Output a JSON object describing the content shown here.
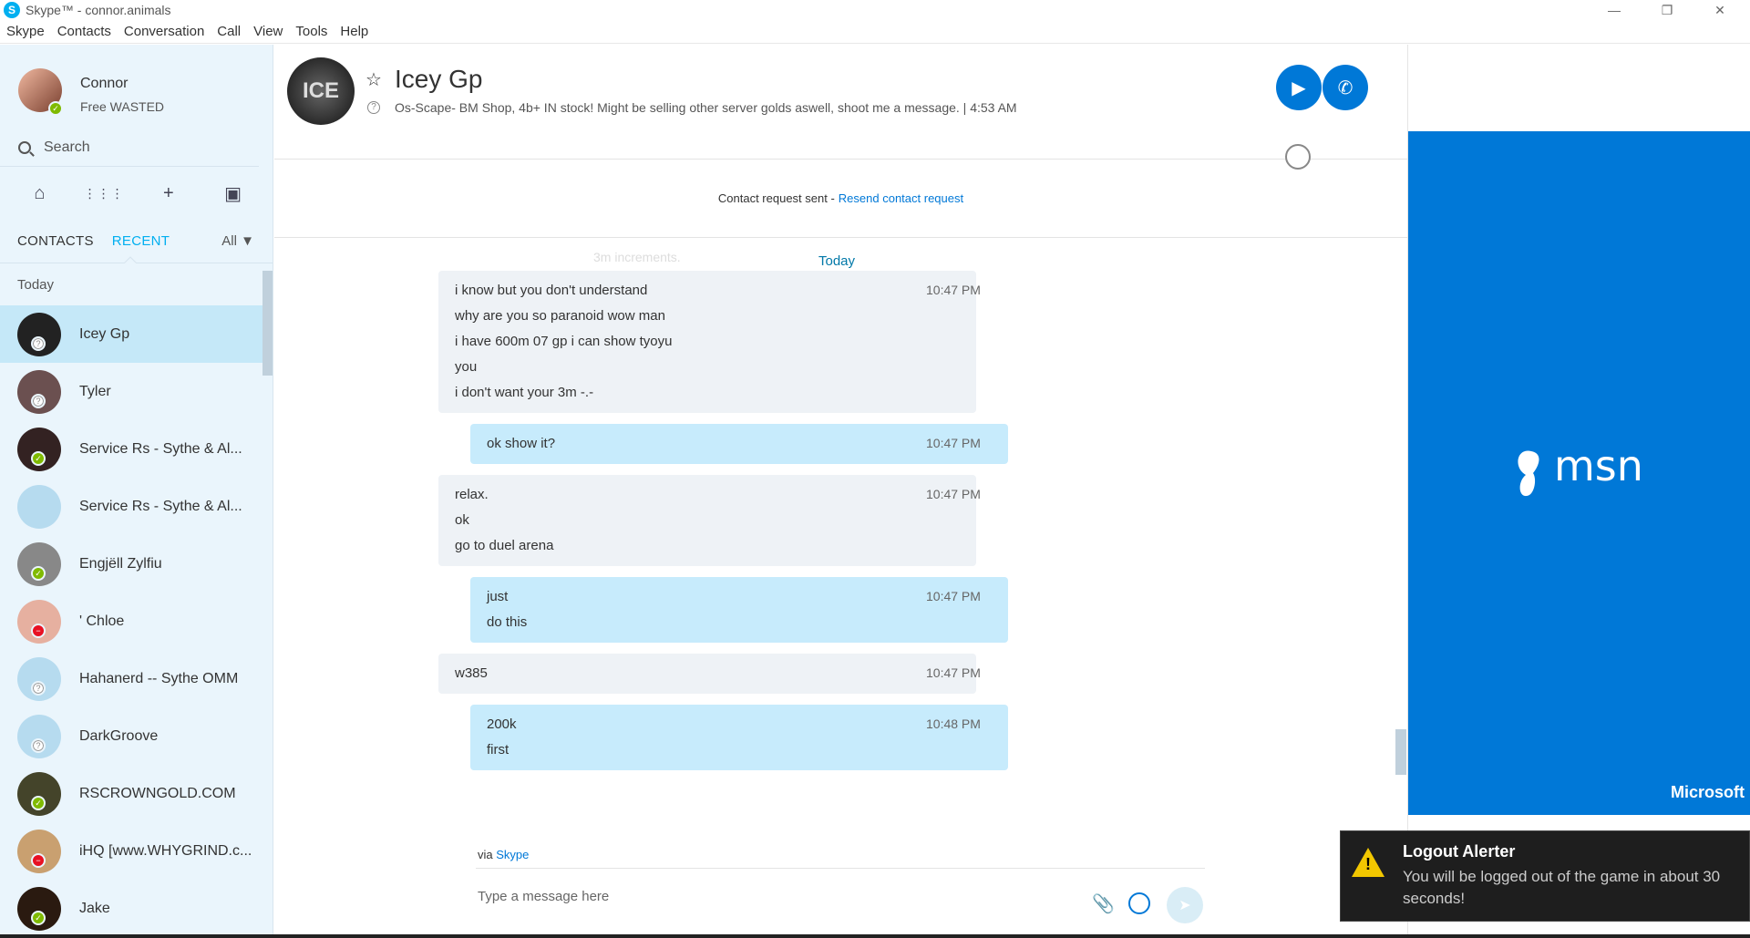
{
  "window": {
    "title": "Skype™ - connor.animals",
    "controls": [
      "minimize",
      "restore",
      "close"
    ]
  },
  "menu": [
    "Skype",
    "Contacts",
    "Conversation",
    "Call",
    "View",
    "Tools",
    "Help"
  ],
  "profile": {
    "name": "Connor",
    "mood": "Free WASTED",
    "presence": "online"
  },
  "search": {
    "placeholder": "Search"
  },
  "icons": [
    "home-icon",
    "dialpad-icon",
    "add-icon",
    "contact-card-icon"
  ],
  "tabs": {
    "contacts": "CONTACTS",
    "recent": "RECENT",
    "filter": "All"
  },
  "list_section": "Today",
  "contacts": [
    {
      "name": "Icey Gp",
      "status": "unknown",
      "active": true,
      "color": "#222222"
    },
    {
      "name": "Tyler",
      "status": "unknown",
      "active": false,
      "color": "#6b5050"
    },
    {
      "name": "Service Rs - Sythe & Al...",
      "status": "online",
      "active": false,
      "color": "#332222"
    },
    {
      "name": "Service Rs - Sythe & Al...",
      "status": "group",
      "active": false,
      "color": "#b6dbef"
    },
    {
      "name": "Engjëll Zylfiu",
      "status": "online",
      "active": false,
      "color": "#888888"
    },
    {
      "name": "' Chloe",
      "status": "dnd",
      "active": false,
      "color": "#e6b0a0"
    },
    {
      "name": "Hahanerd -- Sythe OMM",
      "status": "unknown",
      "active": false,
      "color": "#b6dbef"
    },
    {
      "name": "DarkGroove",
      "status": "unknown",
      "active": false,
      "color": "#b6dbef"
    },
    {
      "name": "RSCROWNGOLD.COM",
      "status": "online",
      "active": false,
      "color": "#44442a"
    },
    {
      "name": "iHQ [www.WHYGRIND.c...",
      "status": "dnd",
      "active": false,
      "color": "#c9a070"
    },
    {
      "name": "Jake",
      "status": "online",
      "active": false,
      "color": "#2a1a10"
    }
  ],
  "chat": {
    "name": "Icey Gp",
    "mood": "Os-Scape- BM Shop, 4b+ IN stock! Might be selling other server golds aswell, shoot me a message.  |  4:53 AM",
    "request_text": "Contact request sent -",
    "request_link": "Resend contact request",
    "day": "Today",
    "ghost": "3m increments.",
    "messages": [
      {
        "dir": "in",
        "lines": [
          "i know but you don't understand",
          "why are you so paranoid wow man",
          "i have 600m 07 gp i can show tyoyu",
          "you",
          "i don't want your 3m -.-"
        ],
        "time": "10:47 PM"
      },
      {
        "dir": "out",
        "lines": [
          "ok show it?"
        ],
        "time": "10:47 PM"
      },
      {
        "dir": "in",
        "lines": [
          "relax.",
          "ok",
          "go to duel arena"
        ],
        "time": "10:47 PM"
      },
      {
        "dir": "out",
        "lines": [
          "just",
          "do this"
        ],
        "time": "10:47 PM"
      },
      {
        "dir": "in",
        "lines": [
          "w385"
        ],
        "time": "10:47 PM"
      },
      {
        "dir": "out",
        "lines": [
          "200k",
          "first"
        ],
        "time": "10:48 PM"
      }
    ],
    "via_label": "via",
    "via_link": "Skype",
    "composer_placeholder": "Type a message here"
  },
  "ad": {
    "brand": "msn",
    "sponsor": "Microsoft",
    "color": "#0078d7"
  },
  "toast": {
    "title": "Logout Alerter",
    "body": "You will be logged out of the game in about 30 seconds!"
  }
}
